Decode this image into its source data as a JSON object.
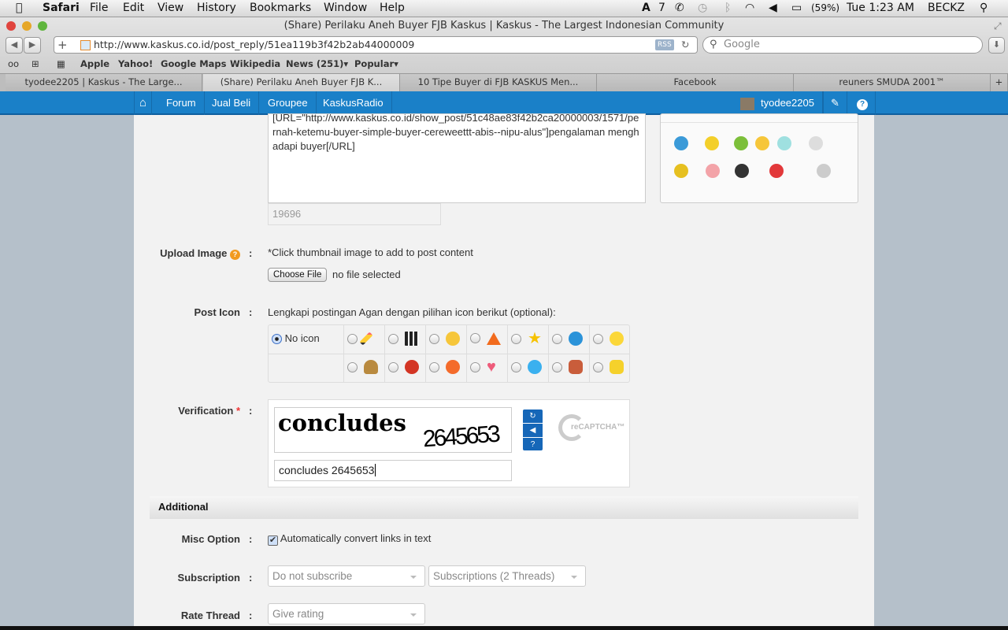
{
  "menubar": {
    "app": "Safari",
    "items": [
      "File",
      "Edit",
      "View",
      "History",
      "Bookmarks",
      "Window",
      "Help"
    ],
    "adobe": "7",
    "battery": "(59%)",
    "clock": "Tue 1:23 AM",
    "user": "BECKZ"
  },
  "window": {
    "title": "(Share) Perilaku Aneh Buyer FJB Kaskus | Kaskus - The Largest Indonesian Community",
    "url": "http://www.kaskus.co.id/post_reply/51ea119b3f42b2ab44000009",
    "rss": "RSS",
    "search_placeholder": "Google"
  },
  "bookmarks": [
    "Apple",
    "Yahoo!",
    "Google Maps",
    "Wikipedia",
    "News (251)▾",
    "Popular▾"
  ],
  "tabs": [
    {
      "label": "tyodee2205 | Kaskus - The Large..."
    },
    {
      "label": "(Share) Perilaku Aneh Buyer FJB K...",
      "active": true
    },
    {
      "label": "10 Tipe Buyer di FJB KASKUS Men..."
    },
    {
      "label": "Facebook"
    },
    {
      "label": "reuners SMUDA 2001™"
    }
  ],
  "kaskus_nav": {
    "items": [
      "Forum",
      "Jual Beli",
      "Groupee",
      "KaskusRadio"
    ],
    "username": "tyodee2205",
    "brand_color": "#1a80c8"
  },
  "editor": {
    "text": "[URL=\"http://www.kaskus.co.id/show_post/51c48ae83f42b2ca20000003/1571/pernah-ketemu-buyer-simple-buyer-cereweettt-abis--nipu-alus\"]pengalaman menghadapi buyer[/URL]",
    "char_count": "19696"
  },
  "upload": {
    "label": "Upload Image",
    "hint": "*Click thumbnail image to add to post content",
    "button": "Choose File",
    "status": "no file selected"
  },
  "post_icon": {
    "label": "Post Icon",
    "hint": "Lengkapi postingan Agan dengan pilihan icon berikut (optional):",
    "no_icon": "No icon",
    "selected": "No icon",
    "icons": [
      "pencil",
      "clapperboard",
      "lightbulb",
      "warning",
      "star",
      "cool",
      "smile",
      "poop",
      "angry",
      "laugh",
      "heart",
      "grin",
      "thumbs-down",
      "thumbs-up"
    ]
  },
  "verification": {
    "label": "Verification",
    "required": "*",
    "captcha_word": "concludes",
    "captcha_number": "2645653",
    "input_value": "concludes 2645653",
    "logo": "reCAPTCHA™"
  },
  "additional": {
    "header": "Additional",
    "misc_label": "Misc Option",
    "misc_checkbox": "Automatically convert links in text",
    "misc_checked": true,
    "subscription_label": "Subscription",
    "subscription_value": "Do not subscribe",
    "subscriptions_folder": "Subscriptions (2 Threads)",
    "rate_label": "Rate Thread",
    "rate_value": "Give rating"
  }
}
